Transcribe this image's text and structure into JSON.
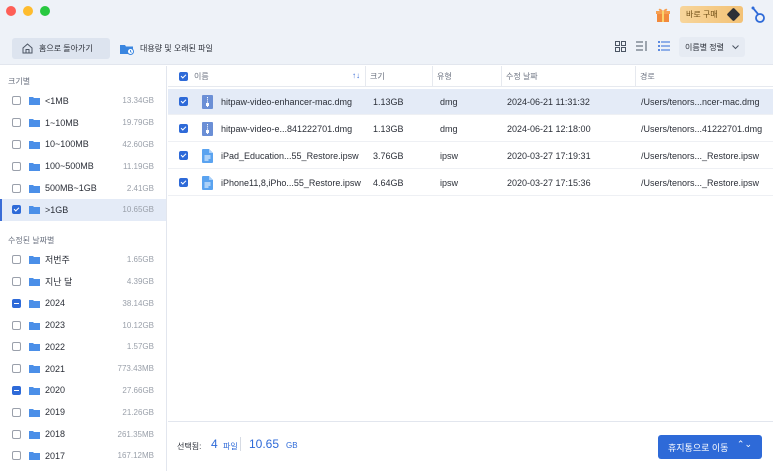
{
  "topbar": {
    "buy_label": "바로 구매",
    "home_label": "홈으로 돌아가기",
    "large_files_label": "대용량 및 오래된 파일",
    "sort_label": "이름별 정렬"
  },
  "sidebar": {
    "size_heading": "크기별",
    "size_items": [
      {
        "label": "<1MB",
        "size": "13.34GB",
        "state": "unchecked"
      },
      {
        "label": "1~10MB",
        "size": "19.79GB",
        "state": "unchecked"
      },
      {
        "label": "10~100MB",
        "size": "42.60GB",
        "state": "unchecked"
      },
      {
        "label": "100~500MB",
        "size": "11.19GB",
        "state": "unchecked"
      },
      {
        "label": "500MB~1GB",
        "size": "2.41GB",
        "state": "unchecked"
      },
      {
        "label": ">1GB",
        "size": "10.65GB",
        "state": "checked"
      }
    ],
    "date_heading": "수정된 날짜별",
    "date_items": [
      {
        "label": "저번주",
        "size": "1.65GB",
        "state": "unchecked"
      },
      {
        "label": "지난 달",
        "size": "4.39GB",
        "state": "unchecked"
      },
      {
        "label": "2024",
        "size": "38.14GB",
        "state": "partial"
      },
      {
        "label": "2023",
        "size": "10.12GB",
        "state": "unchecked"
      },
      {
        "label": "2022",
        "size": "1.57GB",
        "state": "unchecked"
      },
      {
        "label": "2021",
        "size": "773.43MB",
        "state": "unchecked"
      },
      {
        "label": "2020",
        "size": "27.66GB",
        "state": "partial"
      },
      {
        "label": "2019",
        "size": "21.26GB",
        "state": "unchecked"
      },
      {
        "label": "2018",
        "size": "261.35MB",
        "state": "unchecked"
      },
      {
        "label": "2017",
        "size": "167.12MB",
        "state": "unchecked"
      }
    ]
  },
  "table": {
    "headers": {
      "name": "이름",
      "size": "크기",
      "type": "유형",
      "modified": "수정 날짜",
      "path": "경로"
    },
    "sort_arrows": "↑↓",
    "rows": [
      {
        "name": "hitpaw-video-enhancer-mac.dmg",
        "size": "1.13GB",
        "type": "dmg",
        "modified": "2024-06-21 11:31:32",
        "path": "/Users/tenors...ncer-mac.dmg",
        "icon": "dmg-file-icon"
      },
      {
        "name": "hitpaw-video-e...841222701.dmg",
        "size": "1.13GB",
        "type": "dmg",
        "modified": "2024-06-21 12:18:00",
        "path": "/Users/tenors...41222701.dmg",
        "icon": "dmg-file-icon"
      },
      {
        "name": "iPad_Education...55_Restore.ipsw",
        "size": "3.76GB",
        "type": "ipsw",
        "modified": "2020-03-27 17:19:31",
        "path": "/Users/tenors..._Restore.ipsw",
        "icon": "ipsw-file-icon"
      },
      {
        "name": "iPhone11,8,iPho...55_Restore.ipsw",
        "size": "4.64GB",
        "type": "ipsw",
        "modified": "2020-03-27 17:15:36",
        "path": "/Users/tenors..._Restore.ipsw",
        "icon": "ipsw-file-icon"
      }
    ]
  },
  "footer": {
    "selected_label": "선택됨:",
    "count": "4",
    "count_unit": "파일",
    "size_value": "10.65",
    "size_unit": "GB",
    "trash_label": "휴지통으로 이동"
  },
  "colors": {
    "accent": "#2e6ad8",
    "highlight": "#e4ebf7",
    "topbar": "#eef2f8"
  }
}
